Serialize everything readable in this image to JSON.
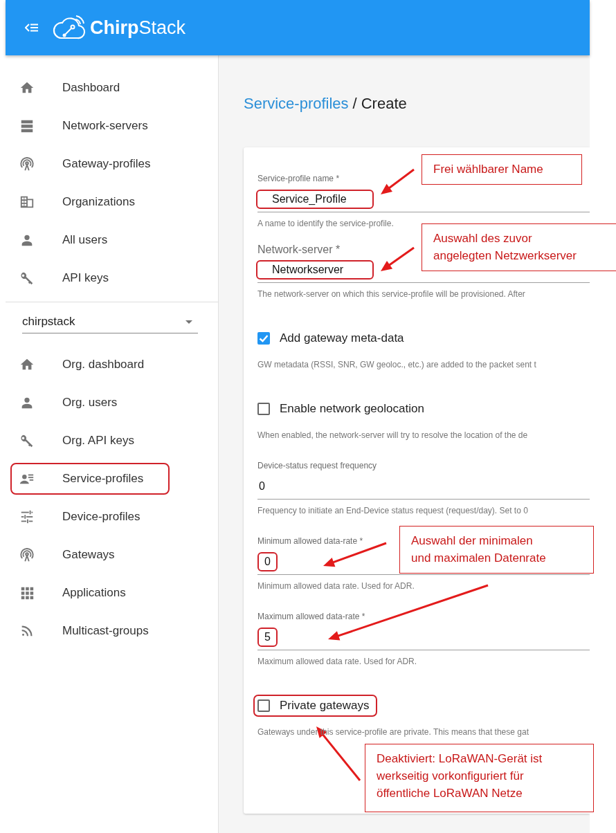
{
  "topbar": {
    "brand": "**Chirp**Stack"
  },
  "sidebar": {
    "items": [
      {
        "label": "Dashboard",
        "highlighted": false
      },
      {
        "label": "Network-servers",
        "highlighted": false
      },
      {
        "label": "Gateway-profiles",
        "highlighted": false
      },
      {
        "label": "Organizations",
        "highlighted": false
      },
      {
        "label": "All users",
        "highlighted": false
      },
      {
        "label": "API keys",
        "highlighted": false
      }
    ],
    "organization_select": {
      "value": "chirpstack"
    },
    "org_items": [
      {
        "label": "Org. dashboard",
        "highlighted": false
      },
      {
        "label": "Org. users",
        "highlighted": false
      },
      {
        "label": "Org. API keys",
        "highlighted": false
      },
      {
        "label": "Service-profiles",
        "highlighted": true
      },
      {
        "label": "Device-profiles",
        "highlighted": false
      },
      {
        "label": "Gateways",
        "highlighted": false
      },
      {
        "label": "Applications",
        "highlighted": false
      },
      {
        "label": "Multicast-groups",
        "highlighted": false
      }
    ]
  },
  "breadcrumb": {
    "link": "Service-profiles",
    "separator": "/",
    "current": "Create"
  },
  "form": {
    "fields": [
      {
        "kind": "text",
        "label": "Service-profile name *",
        "value": "Service_Profile",
        "helper": "A name to identify the service-profile.",
        "highlighted": true
      },
      {
        "kind": "select",
        "label": "Network-server *",
        "value": "Networkserver",
        "helper": "The network-server on which this service-profile will be provisioned. After",
        "highlighted": true
      },
      {
        "kind": "checkbox",
        "label": "Add gateway meta-data",
        "checked": true,
        "helper": "GW metadata (RSSI, SNR, GW geoloc., etc.) are added to the packet sent t",
        "highlighted": false
      },
      {
        "kind": "checkbox",
        "label": "Enable network geolocation",
        "checked": false,
        "helper": "When enabled, the network-server will try to resolve the location of the de",
        "highlighted": false
      },
      {
        "kind": "number",
        "label": "Device-status request frequency",
        "value": "0",
        "helper": "Frequency to initiate an End-Device status request (request/day). Set to 0",
        "highlighted": false
      },
      {
        "kind": "number",
        "label": "Minimum allowed data-rate *",
        "value": "0",
        "helper": "Minimum allowed data rate. Used for ADR.",
        "highlighted": true
      },
      {
        "kind": "number",
        "label": "Maximum allowed data-rate *",
        "value": "5",
        "helper": "Maximum allowed data rate. Used for ADR.",
        "highlighted": true
      },
      {
        "kind": "checkbox",
        "label": "Private gateways",
        "checked": false,
        "helper": "Gateways under this service-profile are private. This means that these gat",
        "highlighted": true
      }
    ]
  },
  "annotations": [
    {
      "lines": [
        "Frei wählbarer Name"
      ]
    },
    {
      "lines": [
        "Auswahl des zuvor",
        "angelegten Netzwerkserver"
      ]
    },
    {
      "lines": [
        "Auswahl der minimalen",
        "und maximalen Datenrate"
      ]
    },
    {
      "lines": [
        "Deaktiviert: LoRaWAN-Gerät ist",
        "werkseitig vorkonfiguriert für",
        "öffentliche LoRaWAN Netze"
      ]
    }
  ]
}
